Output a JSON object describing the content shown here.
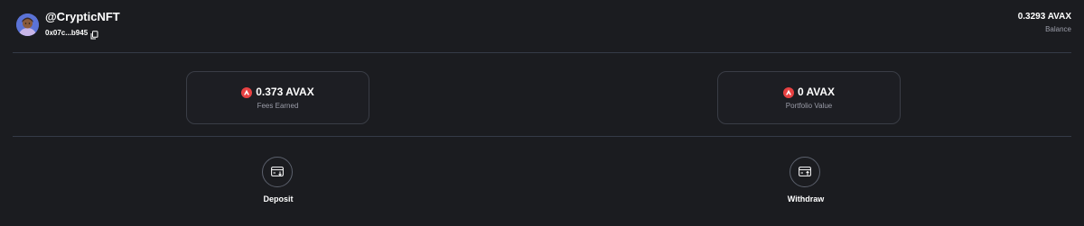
{
  "header": {
    "username": "@CrypticNFT",
    "address": "0x07c...b945",
    "avatar_icon": "user-avatar",
    "copy_icon": "copy-icon",
    "balance_value": "0.3293 AVAX",
    "balance_label": "Balance"
  },
  "stats": [
    {
      "value": "0.373 AVAX",
      "label": "Fees Earned",
      "icon": "avax-icon"
    },
    {
      "value": "0 AVAX",
      "label": "Portfolio Value",
      "icon": "avax-icon"
    }
  ],
  "actions": [
    {
      "label": "Deposit",
      "icon": "card-deposit-icon"
    },
    {
      "label": "Withdraw",
      "icon": "card-withdraw-icon"
    }
  ],
  "colors": {
    "background": "#1b1c20",
    "divider": "#353b47",
    "muted_text": "#9a9ca8",
    "avax_red": "#e84142"
  }
}
